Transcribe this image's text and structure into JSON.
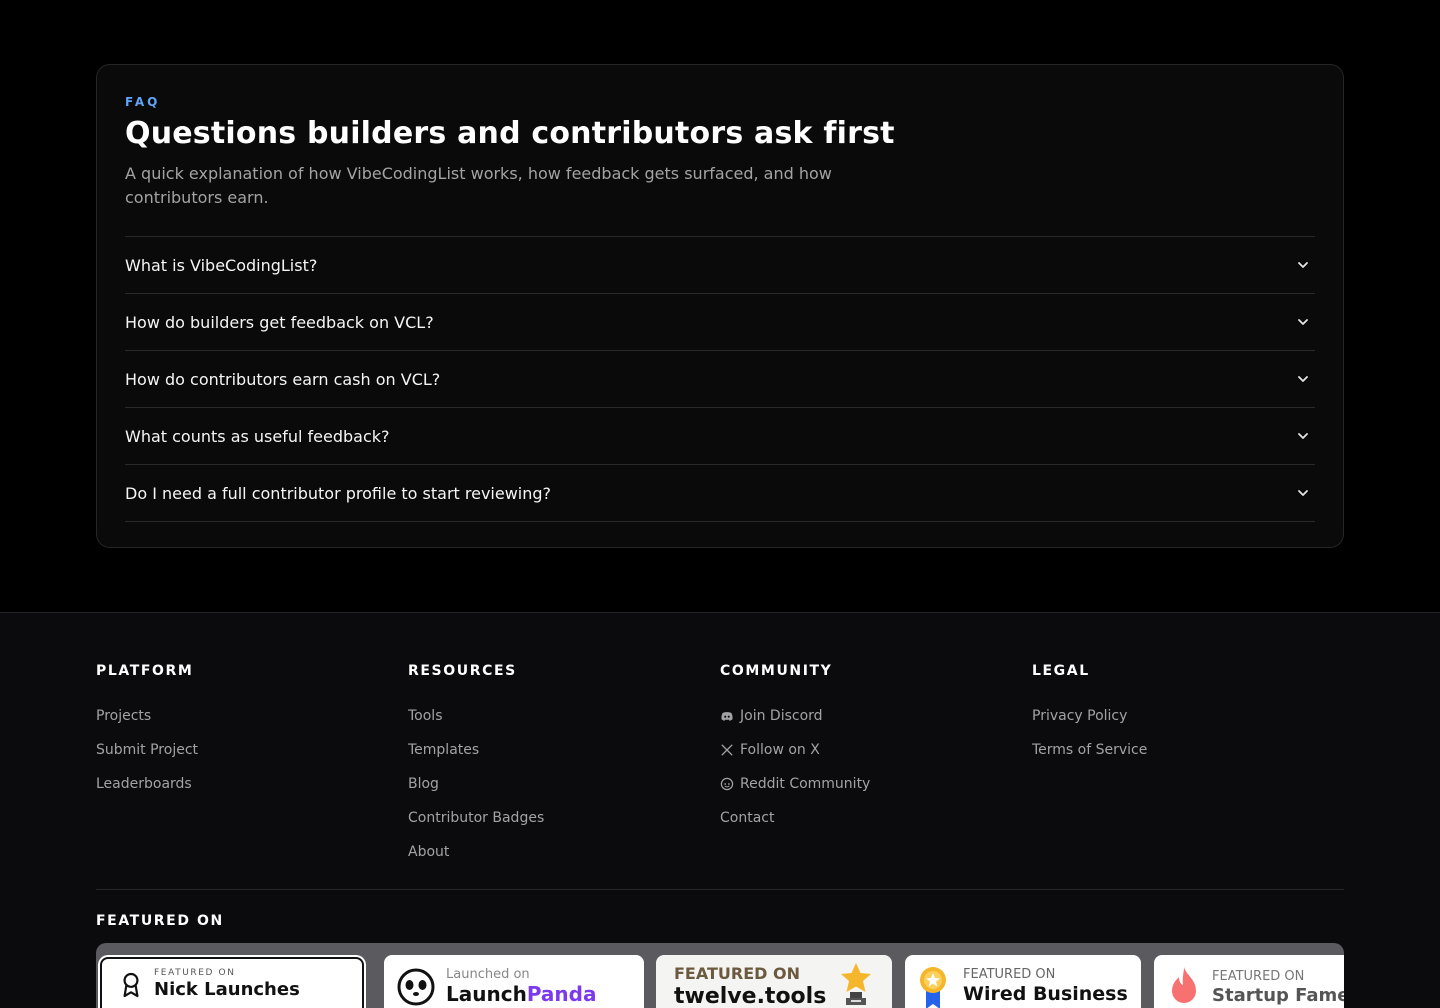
{
  "faq": {
    "eyebrow": "FAQ",
    "title": "Questions builders and contributors ask first",
    "subtitle": "A quick explanation of how VibeCodingList works, how feedback gets surfaced, and how contributors earn.",
    "items": [
      {
        "question": "What is VibeCodingList?"
      },
      {
        "question": "How do builders get feedback on VCL?"
      },
      {
        "question": "How do contributors earn cash on VCL?"
      },
      {
        "question": "What counts as useful feedback?"
      },
      {
        "question": "Do I need a full contributor profile to start reviewing?"
      }
    ]
  },
  "footer": {
    "platform": {
      "heading": "PLATFORM",
      "links": [
        "Projects",
        "Submit Project",
        "Leaderboards"
      ]
    },
    "resources": {
      "heading": "RESOURCES",
      "links": [
        "Tools",
        "Templates",
        "Blog",
        "Contributor Badges",
        "About"
      ]
    },
    "community": {
      "heading": "COMMUNITY",
      "links": [
        {
          "label": "Join Discord",
          "icon": "discord-icon"
        },
        {
          "label": "Follow on X",
          "icon": "x-icon"
        },
        {
          "label": "Reddit Community",
          "icon": "reddit-icon"
        },
        {
          "label": "Contact",
          "icon": ""
        }
      ]
    },
    "legal": {
      "heading": "LEGAL",
      "links": [
        "Privacy Policy",
        "Terms of Service"
      ]
    },
    "featured": {
      "heading": "FEATURED ON",
      "badges": [
        {
          "label": "FEATURED ON",
          "name": "Nick Launches"
        },
        {
          "label": "Launched on",
          "name_a": "Launch",
          "name_b": "Panda"
        },
        {
          "label": "FEATURED ON",
          "name": "twelve.tools"
        },
        {
          "label": "FEATURED ON",
          "name": "Wired Business"
        },
        {
          "label": "FEATURED ON",
          "name": "Startup Fame"
        }
      ]
    }
  },
  "colors": {
    "accent": "#60a5fa",
    "background": "#000000",
    "panda_purple": "#7c3aed"
  }
}
